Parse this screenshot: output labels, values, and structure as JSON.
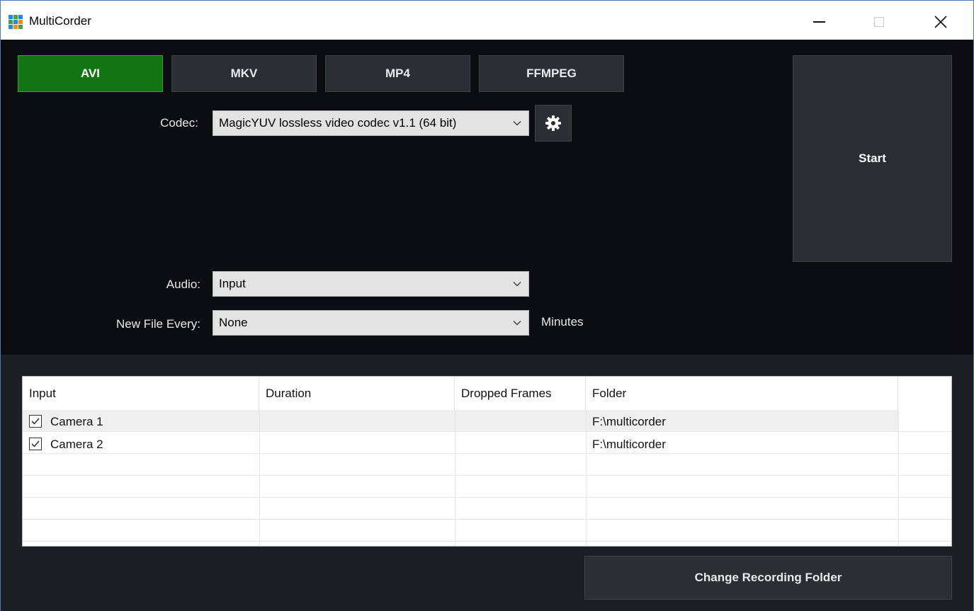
{
  "window": {
    "title": "MultiCorder",
    "icon": "app-grid-icon",
    "controls": {
      "minimize": "minimize-icon",
      "maximize": "maximize-icon",
      "close": "close-icon"
    }
  },
  "formats": {
    "tabs": [
      {
        "label": "AVI",
        "active": true
      },
      {
        "label": "MKV",
        "active": false
      },
      {
        "label": "MP4",
        "active": false
      },
      {
        "label": "FFMPEG",
        "active": false
      }
    ]
  },
  "start_label": "Start",
  "codec": {
    "label": "Codec:",
    "value": "MagicYUV lossless video codec v1.1 (64 bit)",
    "settings_icon": "gear-icon"
  },
  "audio": {
    "label": "Audio:",
    "value": "Input"
  },
  "new_file": {
    "label": "New File Every:",
    "value": "None",
    "unit": "Minutes"
  },
  "table": {
    "columns": [
      "Input",
      "Duration",
      "Dropped Frames",
      "Folder"
    ],
    "rows": [
      {
        "checked": true,
        "input": "Camera 1",
        "duration": "",
        "dropped": "",
        "folder": "F:\\multicorder"
      },
      {
        "checked": true,
        "input": "Camera 2",
        "duration": "",
        "dropped": "",
        "folder": "F:\\multicorder"
      }
    ]
  },
  "change_folder_label": "Change Recording Folder",
  "colors": {
    "active_tab": "#127512",
    "panel_dark": "#0b0d10",
    "panel_bottom": "#1c1f24",
    "button": "#2a2e35"
  }
}
